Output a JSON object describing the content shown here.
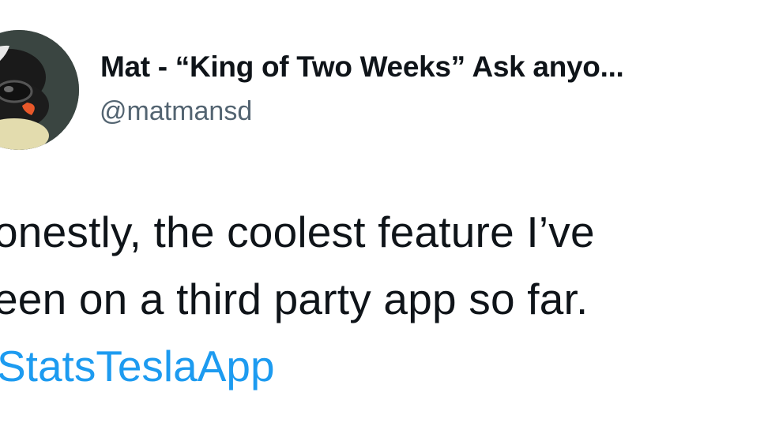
{
  "tweet": {
    "author": {
      "display_name": "Mat - “King of Two Weeks” Ask anyo...",
      "handle": "@matmansd",
      "avatar": "penguin-with-helmet-avatar-icon"
    },
    "text_lines": [
      "onestly, the coolest feature I’ve",
      "een on a third party app so far."
    ],
    "hashtag": "StatsTeslaApp"
  },
  "colors": {
    "text": "#0f1419",
    "handle": "#536471",
    "link": "#1d9bf0",
    "background": "#ffffff"
  }
}
